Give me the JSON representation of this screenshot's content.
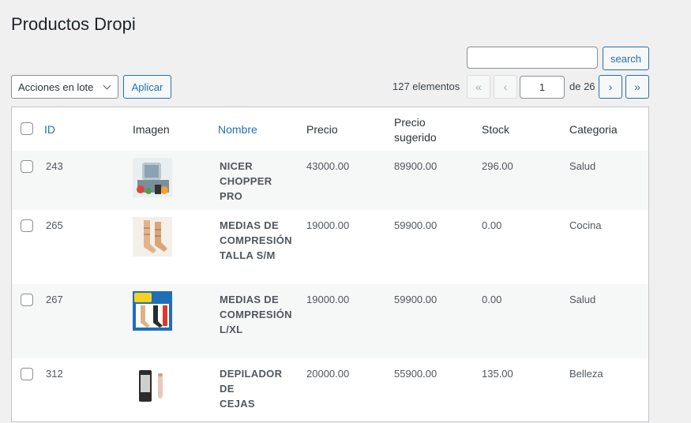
{
  "page": {
    "title": "Productos Dropi"
  },
  "search": {
    "value": "",
    "button_label": "search"
  },
  "bulk": {
    "selected": "Acciones en lote",
    "apply_label": "Aplicar"
  },
  "pagination": {
    "items_count": "127 elementos",
    "first": "«",
    "prev": "‹",
    "current_page": "1",
    "of_total": "de 26",
    "next": "›",
    "last": "»"
  },
  "table": {
    "headers": {
      "id": "ID",
      "image": "Imagen",
      "name": "Nombre",
      "price": "Precio",
      "suggested_line1": "Precio",
      "suggested_line2": "sugerido",
      "stock": "Stock",
      "category": "Categoria"
    },
    "rows": [
      {
        "id": "243",
        "name_lines": [
          "NICER",
          "CHOPPER PRO",
          ""
        ],
        "price": "43000.00",
        "suggested": "89900.00",
        "stock": "296.00",
        "category": "Salud",
        "image_icon": "chopper-product-image"
      },
      {
        "id": "265",
        "name_lines": [
          "MEDIAS DE",
          "COMPRESIÓN",
          "TALLA S/M"
        ],
        "price": "19000.00",
        "suggested": "59900.00",
        "stock": "0.00",
        "category": "Cocina",
        "image_icon": "compression-socks-image"
      },
      {
        "id": "267",
        "name_lines": [
          "MEDIAS DE",
          "COMPRESIÓN",
          "L/XL"
        ],
        "price": "19000.00",
        "suggested": "59900.00",
        "stock": "0.00",
        "category": "Salud",
        "image_icon": "zipsox-box-image"
      },
      {
        "id": "312",
        "name_lines": [
          "DEPILADOR DE",
          "CEJAS",
          ""
        ],
        "price": "20000.00",
        "suggested": "55900.00",
        "stock": "135.00",
        "category": "Belleza",
        "image_icon": "eyebrow-trimmer-image"
      }
    ]
  },
  "colors": {
    "link": "#2271b1",
    "background": "#f0f0f1",
    "row_alt": "#f6f7f7"
  }
}
